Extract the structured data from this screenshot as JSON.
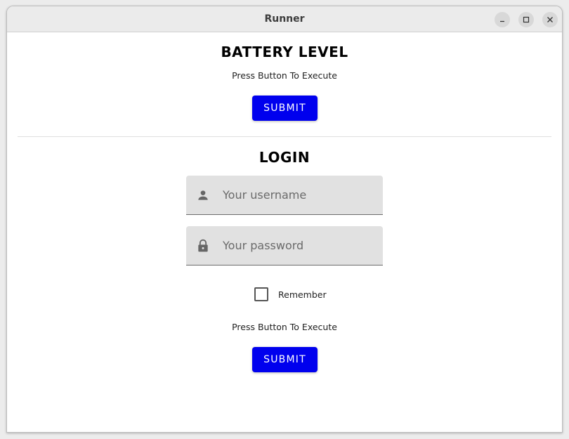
{
  "window": {
    "title": "Runner"
  },
  "battery": {
    "heading": "BATTERY LEVEL",
    "caption": "Press Button To Execute",
    "submit_label": "SUBMIT"
  },
  "login": {
    "heading": "LOGIN",
    "username": {
      "placeholder": "Your username",
      "value": "",
      "icon": "person-icon"
    },
    "password": {
      "placeholder": "Your password",
      "value": "",
      "icon": "lock-icon"
    },
    "remember_label": "Remember",
    "remember_checked": false,
    "caption": "Press Button To Execute",
    "submit_label": "SUBMIT"
  },
  "colors": {
    "accent": "#0000ee",
    "field_bg": "#e1e1e1"
  }
}
